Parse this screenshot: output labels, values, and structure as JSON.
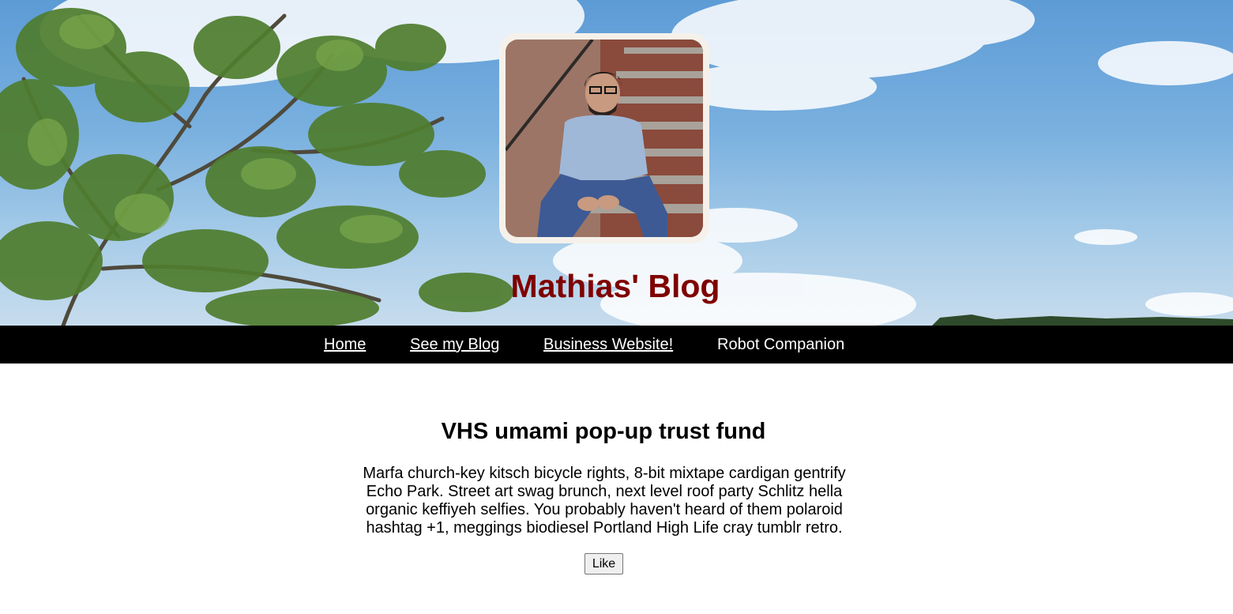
{
  "header": {
    "site_title": "Mathias' Blog",
    "background_image": "tree-and-sky-photo",
    "avatar_image": "man-sitting-on-stairs-photo"
  },
  "nav": {
    "items": [
      {
        "label": "Home",
        "underlined": true
      },
      {
        "label": "See my Blog",
        "underlined": true
      },
      {
        "label": "Business Website!",
        "underlined": true
      },
      {
        "label": "Robot Companion",
        "underlined": false
      }
    ]
  },
  "post": {
    "title": "VHS umami pop-up trust fund",
    "body": "Marfa church-key kitsch bicycle rights, 8-bit mixtape cardigan gentrify Echo Park. Street art swag brunch, next level roof party Schlitz hella organic keffiyeh selfies. You probably haven't heard of them polaroid hashtag +1, meggings biodiesel Portland High Life cray tumblr retro.",
    "like_label": "Like"
  },
  "colors": {
    "title": "#7f0000",
    "nav_background": "#000000",
    "nav_text": "#ffffff"
  }
}
